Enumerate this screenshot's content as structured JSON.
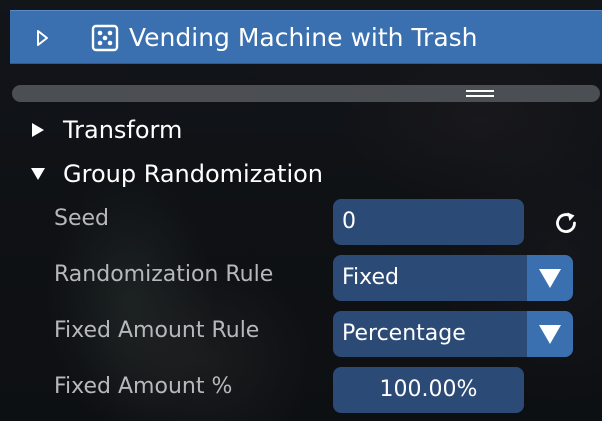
{
  "header": {
    "title": "Vending Machine with Trash",
    "colors": {
      "bar": "#3a6fb0",
      "text": "#ffffff"
    }
  },
  "tree": {
    "transform": {
      "label": "Transform",
      "expanded": false
    },
    "group_randomization": {
      "label": "Group Randomization",
      "expanded": true
    }
  },
  "properties": {
    "seed": {
      "label": "Seed",
      "value": "0",
      "action_icon": "refresh-icon"
    },
    "randomization_rule": {
      "label": "Randomization Rule",
      "value": "Fixed"
    },
    "fixed_amount_rule": {
      "label": "Fixed Amount Rule",
      "value": "Percentage"
    },
    "fixed_amount_percent": {
      "label": "Fixed Amount %",
      "value": "100.00%"
    }
  },
  "colors": {
    "field_bg": "#2b4a76",
    "accent": "#3a6fb0",
    "label_text": "#b6b8bb",
    "splitter": "#4b4e53"
  }
}
